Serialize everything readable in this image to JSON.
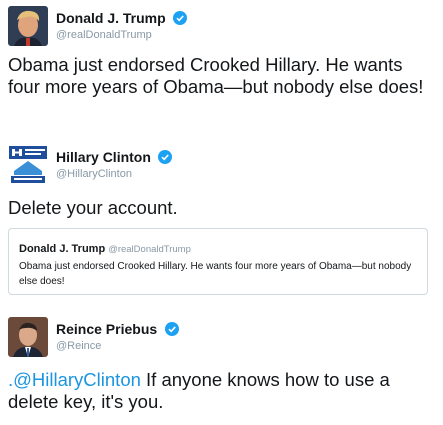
{
  "tweets": [
    {
      "name": "Donald J. Trump",
      "handle": "@realDonaldTrump",
      "text": "Obama just endorsed Crooked Hillary. He wants four more years of Obama—but nobody else does!"
    },
    {
      "name": "Hillary Clinton",
      "handle": "@HillaryClinton",
      "text": "Delete your account.",
      "quote": {
        "name": "Donald J. Trump",
        "handle": "@realDonaldTrump",
        "text": "Obama just endorsed Crooked Hillary. He wants four more years of Obama—but nobody else does!"
      }
    },
    {
      "name": "Reince Priebus",
      "handle": "@Reince",
      "mention": ".@HillaryClinton",
      "text": " If anyone knows how to use a delete key, it's you."
    }
  ],
  "colors": {
    "verified": "#1da1f2",
    "link": "#1b95e0",
    "secondary": "#8899a6"
  },
  "icons": [
    "verified-badge-icon"
  ]
}
